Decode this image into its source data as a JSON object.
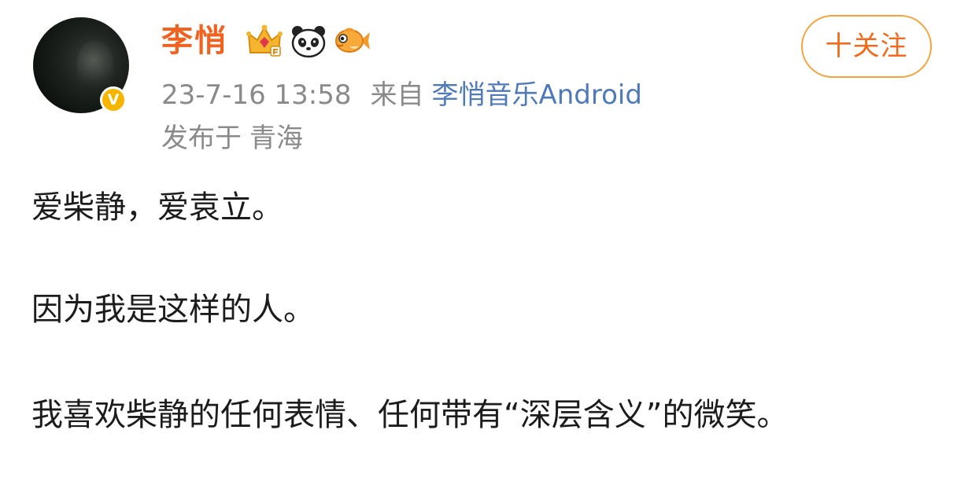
{
  "user": {
    "name": "李悄",
    "avatar_icon": "profile-photo",
    "verified_icon": "verified-v-badge",
    "verified_mark": "V",
    "badges": [
      "crown-vip-icon",
      "panda-icon",
      "goldfish-icon"
    ]
  },
  "follow_button": {
    "label": "十关注"
  },
  "meta": {
    "time": "23-7-16 13:58",
    "source_prefix": "来自",
    "source": "李悄音乐Android",
    "location_prefix": "发布于",
    "location": "青海"
  },
  "post": {
    "paragraphs": [
      "爱柴静，爱袁立。",
      "因为我是这样的人。",
      "我喜欢柴静的任何表情、任何带有“深层含义”的微笑。"
    ]
  },
  "colors": {
    "username": "#f0621f",
    "follow_border": "#f7a23b",
    "source_link": "#4f7ab8",
    "meta_text": "#8a8a8a",
    "verified": "#f7b500"
  }
}
